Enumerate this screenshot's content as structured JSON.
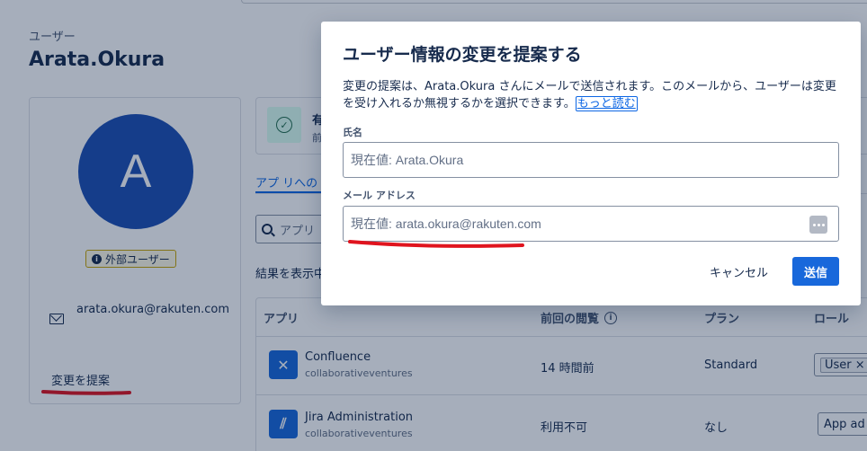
{
  "breadcrumb": "ユーザー",
  "user": {
    "name": "Arata.Okura",
    "avatar_initial": "A",
    "badge": "外部ユーザー",
    "email": "arata.okura@rakuten.com",
    "suggest_change": "変更を提案"
  },
  "status": {
    "title": "有",
    "subtitle": "前"
  },
  "tabs": {
    "apps": "アプ リへの"
  },
  "search": {
    "placeholder": "アプリ"
  },
  "results_label": "結果を表示中",
  "table": {
    "headers": {
      "app": "アプリ",
      "last_viewed": "前回の閲覧",
      "plan": "プラン",
      "role": "ロール"
    },
    "rows": [
      {
        "app": "Confluence",
        "site": "collaborativeventures",
        "last_viewed": "14 時間前",
        "plan": "Standard",
        "role": "User ×"
      },
      {
        "app": "Jira Administration",
        "site": "collaborativeventures",
        "last_viewed": "利用不可",
        "plan": "なし",
        "role": "App ad"
      }
    ]
  },
  "modal": {
    "title": "ユーザー情報の変更を提案する",
    "description": "変更の提案は、Arata.Okura さんにメールで送信されます。このメールから、ユーザーは変更を受け入れるか無視するかを選択できます。",
    "more_link": "もっと読む",
    "name_label": "氏名",
    "name_placeholder": "現在値: Arata.Okura",
    "email_label": "メール アドレス",
    "email_placeholder": "現在値: arata.okura@rakuten.com",
    "cancel": "キャンセル",
    "submit": "送信"
  },
  "colors": {
    "accent": "#1868db",
    "avatar": "#1d4fb3",
    "annotation": "#e0141e"
  }
}
